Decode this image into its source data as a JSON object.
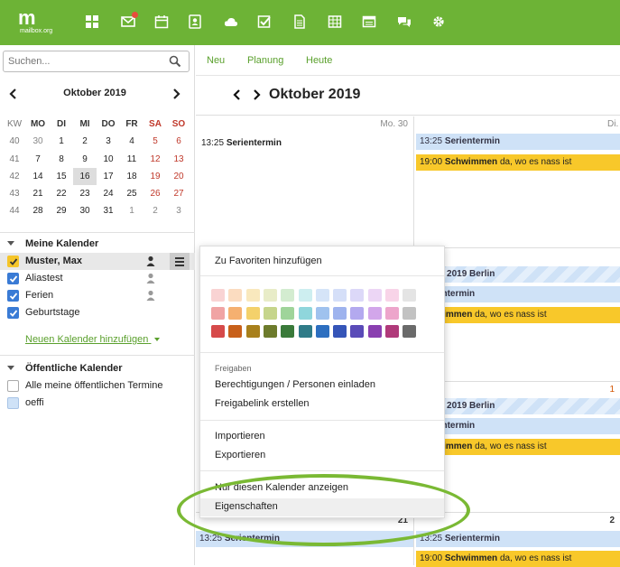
{
  "logo": {
    "mark": "m",
    "sub": "mailbox.org"
  },
  "topnav": [
    {
      "icon": "grid-icon"
    },
    {
      "icon": "mail-icon",
      "badge": true
    },
    {
      "icon": "calendar-icon"
    },
    {
      "icon": "address-book-icon"
    },
    {
      "icon": "cloud-icon"
    },
    {
      "icon": "tasks-icon"
    },
    {
      "icon": "document-icon"
    },
    {
      "icon": "spreadsheet-icon"
    },
    {
      "icon": "presentation-icon"
    },
    {
      "icon": "chat-icon"
    },
    {
      "icon": "gear-icon"
    }
  ],
  "search": {
    "placeholder": "Suchen..."
  },
  "mini_calendar": {
    "title": "Oktober 2019",
    "headers": [
      "KW",
      "MO",
      "DI",
      "MI",
      "DO",
      "FR",
      "SA",
      "SO"
    ],
    "weeks": [
      [
        "40",
        "30",
        "1",
        "2",
        "3",
        "4",
        "5",
        "6"
      ],
      [
        "41",
        "7",
        "8",
        "9",
        "10",
        "11",
        "12",
        "13"
      ],
      [
        "42",
        "14",
        "15",
        "16",
        "17",
        "18",
        "19",
        "20"
      ],
      [
        "43",
        "21",
        "22",
        "23",
        "24",
        "25",
        "26",
        "27"
      ],
      [
        "44",
        "28",
        "29",
        "30",
        "31",
        "1",
        "2",
        "3"
      ]
    ],
    "today": "16"
  },
  "my_calendars": {
    "title": "Meine Kalender",
    "items": [
      {
        "label": "Muster, Max",
        "color": "#f5c52a",
        "checked": true,
        "shared": true,
        "selected": true
      },
      {
        "label": "Aliastest",
        "color": "#3a7bd5",
        "checked": true,
        "shared": true
      },
      {
        "label": "Ferien",
        "color": "#3a7bd5",
        "checked": true,
        "shared": true
      },
      {
        "label": "Geburtstage",
        "color": "#3a7bd5",
        "checked": true,
        "shared": false
      }
    ],
    "add_link": "Neuen Kalender hinzufügen"
  },
  "public_calendars": {
    "title": "Öffentliche Kalender",
    "items": [
      {
        "label": "Alle meine öffentlichen Termine",
        "color": "#ffffff"
      },
      {
        "label": "oeffi",
        "color": "#cfe2f7"
      }
    ]
  },
  "toolbar": {
    "new": "Neu",
    "planning": "Planung",
    "today": "Heute"
  },
  "calendar": {
    "title": "Oktober 2019"
  },
  "days": [
    {
      "label": "Mo. 30",
      "extra": "",
      "events": [
        {
          "type": "plain",
          "time": "13:25",
          "title": "Serientermin",
          "note": ""
        }
      ]
    },
    {
      "label": "Di.",
      "events": [
        {
          "type": "blue",
          "time": "13:25",
          "title": "Serientermin",
          "note": ""
        },
        {
          "type": "yellow",
          "time": "19:00",
          "title": "Schwimmen",
          "note": " da, wo es nass ist"
        }
      ]
    },
    {
      "label": "",
      "events": [
        {
          "type": "stripe",
          "time": "",
          "title": "ferien 2019 Berlin",
          "note": ""
        },
        {
          "type": "blue",
          "time": "",
          "title": "Serientermin",
          "note": ""
        },
        {
          "type": "yellow",
          "time": "",
          "title": "Schwimmen",
          "note": " da, wo es nass ist"
        }
      ]
    },
    {
      "label": "1",
      "events": [
        {
          "type": "stripe",
          "time": "",
          "title": "ferien 2019 Berlin",
          "note": ""
        },
        {
          "type": "blue",
          "time": "",
          "title": "Serientermin",
          "note": ""
        },
        {
          "type": "yellow",
          "time": "",
          "title": "Schwimmen",
          "note": " da, wo es nass ist"
        }
      ]
    },
    {
      "label": "21",
      "events": [
        {
          "type": "blue",
          "time": "13:25",
          "title": "Serientermin",
          "note": ""
        }
      ]
    },
    {
      "label": "2",
      "events": [
        {
          "type": "blue",
          "time": "13:25",
          "title": "Serientermin",
          "note": ""
        },
        {
          "type": "yellow",
          "time": "19:00",
          "title": "Schwimmen",
          "note": " da, wo es nass ist"
        }
      ]
    }
  ],
  "context_menu": {
    "favorite": "Zu Favoriten hinzufügen",
    "colors": [
      [
        "#f9d3d3",
        "#fbdcc0",
        "#f9e8bd",
        "#e8ecc8",
        "#d3ecd0",
        "#cdeef0",
        "#d5e4f8",
        "#d5dff8",
        "#dcd8f8",
        "#ecd6f5",
        "#f8d4e8",
        "#e4e4e4"
      ],
      [
        "#f0a4a4",
        "#f5b070",
        "#f4d16b",
        "#c6d58b",
        "#9fd49a",
        "#8fd6dc",
        "#9fc2ee",
        "#9eb3ee",
        "#b3a9ef",
        "#d2a6ea",
        "#eda5cb",
        "#c2c2c2"
      ],
      [
        "#d64a4a",
        "#c8601a",
        "#a8801c",
        "#6d7b2c",
        "#3a7a3a",
        "#2f7b88",
        "#2d6fc0",
        "#3555b8",
        "#5a4bb8",
        "#8a3fb0",
        "#b03a7a",
        "#6a6a6a"
      ]
    ],
    "share_label": "Freigaben",
    "share_invite": "Berechtigungen / Personen einladen",
    "share_link": "Freigabelink erstellen",
    "import": "Importieren",
    "export": "Exportieren",
    "only_this": "Nur diesen Kalender anzeigen",
    "properties": "Eigenschaften"
  },
  "colors": {
    "brand": "#6db336",
    "link": "#5aa02c",
    "event_blue": "#cfe2f7",
    "event_yellow": "#f8c82a"
  }
}
